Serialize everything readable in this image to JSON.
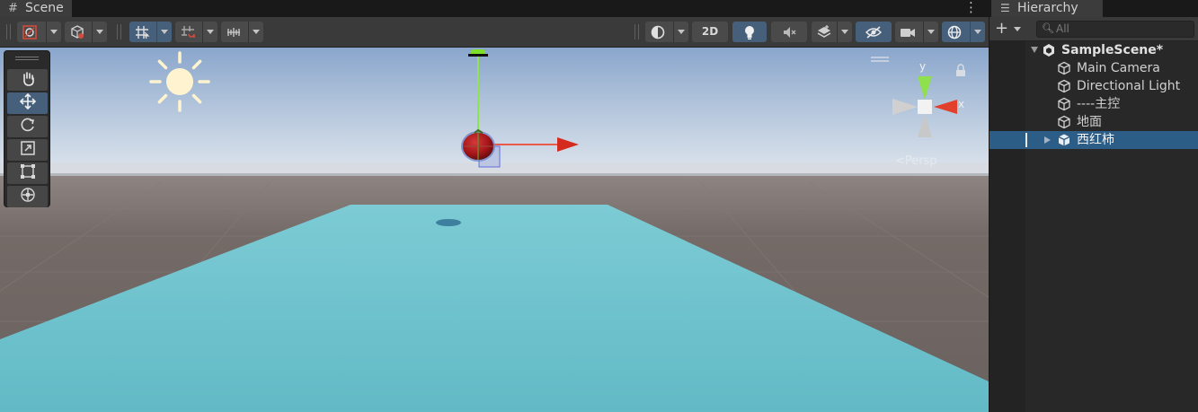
{
  "scene_tab": {
    "title": "Scene",
    "tab_icon": "grid-icon",
    "menu_icon": "kebab-icon"
  },
  "toolbar": {
    "draw_mode_icon": "shading-mode-icon",
    "gizmo_mode_icon": "object-mode-icon",
    "grid_snap_icon": "grid-snapping-icon",
    "increment_snap_icon": "increment-snap-icon",
    "ruler_icon": "ruler-icon",
    "render_mode_icon": "render-mode-icon",
    "mode_2d_label": "2D",
    "lighting_icon": "lightbulb-icon",
    "audio_icon": "speaker-mute-icon",
    "effects_icon": "effects-layers-icon",
    "hidden_objects_icon": "eye-hidden-icon",
    "camera_icon": "camera-icon",
    "gizmos_icon": "gizmos-globe-icon"
  },
  "tools": [
    {
      "name": "hand-tool",
      "icon": "hand-icon",
      "active": false
    },
    {
      "name": "move-tool",
      "icon": "move-icon",
      "active": true
    },
    {
      "name": "rotate-tool",
      "icon": "rotate-icon",
      "active": false
    },
    {
      "name": "scale-tool",
      "icon": "scale-icon",
      "active": false
    },
    {
      "name": "rect-tool",
      "icon": "rect-icon",
      "active": false
    },
    {
      "name": "transform-tool",
      "icon": "transform-icon",
      "active": false
    }
  ],
  "viewport": {
    "projection_label": "<Persp",
    "axis_y_label": "y",
    "axis_x_label": "x",
    "sky_top": "#8aa6cc",
    "sky_horizon": "#dde4ec",
    "ground_color": "#6f6663",
    "plane_color": "#6cc4ce",
    "object_color": "#a8161a"
  },
  "hierarchy": {
    "title": "Hierarchy",
    "tab_icon": "list-icon",
    "add_label": "+",
    "search_placeholder": "All",
    "scene_name": "SampleScene*",
    "objects": [
      {
        "label": "Main Camera",
        "selected": false,
        "has_children": false
      },
      {
        "label": "Directional Light",
        "selected": false,
        "has_children": false
      },
      {
        "label": "----主控",
        "selected": false,
        "has_children": false
      },
      {
        "label": "地面",
        "selected": false,
        "has_children": false
      },
      {
        "label": "西红柿",
        "selected": true,
        "has_children": true
      }
    ]
  }
}
